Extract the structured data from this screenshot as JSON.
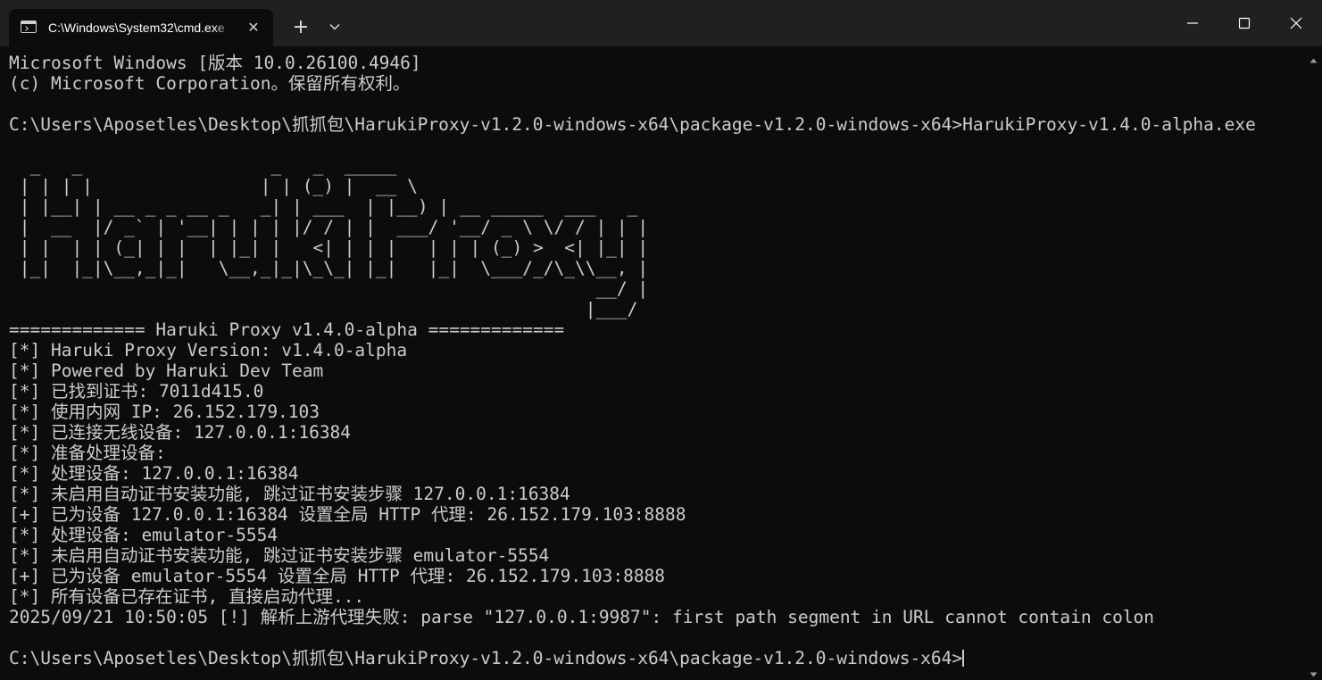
{
  "window": {
    "tab_title": "C:\\Windows\\System32\\cmd.exe",
    "tab_close_glyph": "✕",
    "new_tab_glyph": "+"
  },
  "terminal": {
    "lines": [
      "Microsoft Windows [版本 10.0.26100.4946]",
      "(c) Microsoft Corporation。保留所有权利。",
      "",
      "C:\\Users\\Aposetles\\Desktop\\抓抓包\\HarukiProxy-v1.2.0-windows-x64\\package-v1.2.0-windows-x64>HarukiProxy-v1.4.0-alpha.exe",
      "",
      "  _   _                  _   _  _____",
      " | | | |                | | (_) |  __ \\",
      " | |__| | __ _ _ __ _   _| | ___  | |__) | __ _____  ___   _",
      " |  __  |/ _` | '__| | | | |/ / | |  ___/ '__/ _ \\ \\/ / | | |",
      " | |  | | (_| | |  | |_| |   <| | | |   | | | (_) >  <| |_| |",
      " |_|  |_|\\__,_|_|   \\__,_|_|\\_\\_| |_|   |_|  \\___/_/\\_\\\\__, |",
      "                                                        __/ |",
      "                                                       |___/",
      "============= Haruki Proxy v1.4.0-alpha =============",
      "[*] Haruki Proxy Version: v1.4.0-alpha",
      "[*] Powered by Haruki Dev Team",
      "[*] 已找到证书: 7011d415.0",
      "[*] 使用内网 IP: 26.152.179.103",
      "[*] 已连接无线设备: 127.0.0.1:16384",
      "[*] 准备处理设备:",
      "[*] 处理设备: 127.0.0.1:16384",
      "[*] 未启用自动证书安装功能, 跳过证书安装步骤 127.0.0.1:16384",
      "[+] 已为设备 127.0.0.1:16384 设置全局 HTTP 代理: 26.152.179.103:8888",
      "[*] 处理设备: emulator-5554",
      "[*] 未启用自动证书安装功能, 跳过证书安装步骤 emulator-5554",
      "[+] 已为设备 emulator-5554 设置全局 HTTP 代理: 26.152.179.103:8888",
      "[*] 所有设备已存在证书, 直接启动代理...",
      "2025/09/21 10:50:05 [!] 解析上游代理失败: parse \"127.0.0.1:9987\": first path segment in URL cannot contain colon",
      ""
    ],
    "prompt": "C:\\Users\\Aposetles\\Desktop\\抓抓包\\HarukiProxy-v1.2.0-windows-x64\\package-v1.2.0-windows-x64>"
  },
  "colors": {
    "terminal_bg": "#0c0c0c",
    "terminal_fg": "#cccccc",
    "titlebar_bg": "#202020"
  },
  "icons": {
    "tab_icon": "terminal-app-icon",
    "close_tab": "close-icon",
    "new_tab": "plus-icon",
    "dropdown": "chevron-down-icon",
    "minimize": "minimize-icon",
    "maximize": "maximize-icon",
    "close_window": "close-icon",
    "scroll_up": "scroll-up-arrow-icon",
    "scroll_down": "scroll-down-arrow-icon"
  }
}
